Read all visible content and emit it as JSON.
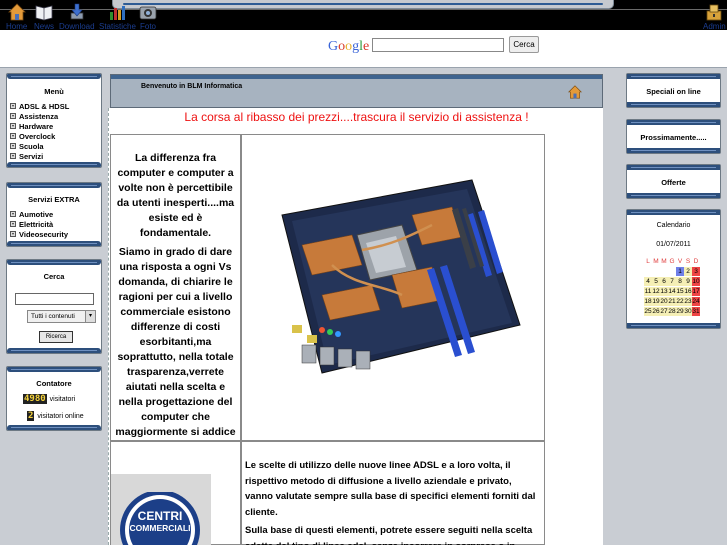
{
  "toolbar": {
    "items": [
      {
        "label": "Home",
        "icon": "home-icon"
      },
      {
        "label": "News",
        "icon": "book-icon"
      },
      {
        "label": "Download",
        "icon": "download-icon"
      },
      {
        "label": "Statistiche",
        "icon": "chart-icon"
      },
      {
        "label": "Foto",
        "icon": "camera-icon"
      }
    ],
    "admin_label": "Admin",
    "google_label": "Google",
    "search_value": "",
    "search_button": "Cerca"
  },
  "left": {
    "menu": {
      "title": "Menù",
      "items": [
        "ADSL & HDSL",
        "Assistenza",
        "Hardware",
        "Overclock",
        "Scuola",
        "Servizi"
      ]
    },
    "extra": {
      "title": "Servizi EXTRA",
      "items": [
        "Aumotive",
        "Elettricità",
        "Videosecurity"
      ]
    },
    "search": {
      "title": "Cerca",
      "input_value": "",
      "select_value": "Tutti i contenuti",
      "button": "Ricerca"
    },
    "counter": {
      "title": "Contatore",
      "visits": "4980",
      "visits_label": "visitatori",
      "online": "2",
      "online_label": "visitatori online"
    }
  },
  "center": {
    "header_title": "Benvenuto in BLM Informatica",
    "headline": "La corsa al ribasso dei prezzi....trascura il servizio di assistenza !",
    "intro_p1": "La differenza fra computer e computer a volte non è percettibile da utenti inesperti....ma esiste ed è fondamentale.",
    "intro_p2": "Siamo in grado di dare una risposta a ogni Vs domanda, di chiarire le ragioni per cui a livello commerciale esistono differenze di costi esorbitanti,ma soprattutto, nella totale trasparenza,verrete aiutati nella scelta e nella progettazione del computer che maggiormente si addice alle Vs esigenze.",
    "adsl_p1": "Le scelte di utilizzo delle nuove linee ADSL e a loro volta, il rispettivo metodo di diffusione a livello aziendale e privato, vanno valutate sempre sulla base di specifici elementi forniti dal cliente.",
    "adsl_p2": "Sulla base di questi elementi, potrete essere seguiti nella scelta adatta del tipo di linea adsl, senza incorrere in sorprese o in malintesi che spesso portano a spese considerevoli.",
    "badge_line1": "CENTRI",
    "badge_line2": "COMMERCIALI"
  },
  "right": {
    "speciali": "Speciali on line",
    "prossimamente": "Prossimamente.....",
    "offerte": "Offerte",
    "calendar": {
      "title": "Calendario",
      "month": "01/07/2011",
      "weekdays": [
        "L",
        "M",
        "M",
        "G",
        "V",
        "S",
        "D"
      ],
      "weeks": [
        [
          "",
          "",
          "",
          "",
          "1",
          "2",
          "3"
        ],
        [
          "4",
          "5",
          "6",
          "7",
          "8",
          "9",
          "10"
        ],
        [
          "11",
          "12",
          "13",
          "14",
          "15",
          "16",
          "17"
        ],
        [
          "18",
          "19",
          "20",
          "21",
          "22",
          "23",
          "24"
        ],
        [
          "25",
          "26",
          "27",
          "28",
          "29",
          "30",
          "31"
        ]
      ]
    }
  },
  "colors": {
    "headline": "#ee1111",
    "accent_blue": "#2d4f7c",
    "weekend": "#ee4444",
    "today": "#6f7fe8",
    "weekday_cell": "#f5efb5"
  }
}
